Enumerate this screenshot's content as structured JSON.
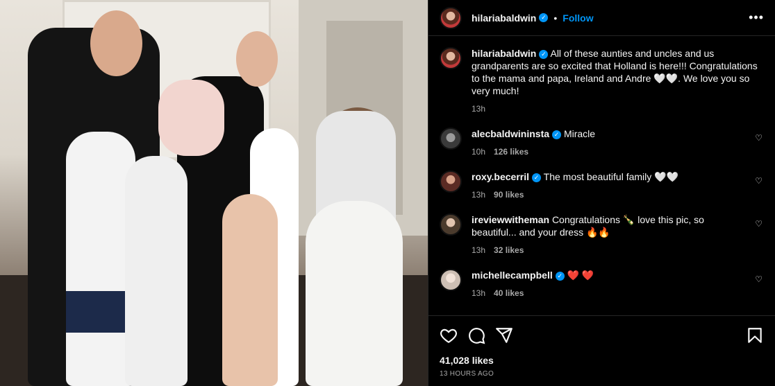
{
  "post": {
    "username": "hilariabaldwin",
    "follow_label": "Follow",
    "dot": "•",
    "more": "•••",
    "photo_alt": "Family photo"
  },
  "caption": {
    "username": "hilariabaldwin",
    "text": "All of these aunties and uncles and us grandparents are so excited that Holland is here!!! Congratulations to the mama and papa, Ireland and Andre 🤍🤍. We love you so very much!",
    "time": "13h"
  },
  "comments": [
    {
      "username": "alecbaldwininsta",
      "verified": true,
      "text": "Miracle",
      "time": "10h",
      "likes": "126 likes"
    },
    {
      "username": "roxy.becerril",
      "verified": true,
      "text": "The most beautiful family 🤍🤍",
      "time": "13h",
      "likes": "90 likes"
    },
    {
      "username": "ireviewwitheman",
      "verified": false,
      "text": "Congratulations 🍾 love this pic, so beautiful... and your dress 🔥🔥",
      "time": "13h",
      "likes": "32 likes"
    },
    {
      "username": "michellecampbell",
      "verified": true,
      "text": "❤️ ❤️",
      "time": "13h",
      "likes": "40 likes"
    }
  ],
  "footer": {
    "likes": "41,028 likes",
    "timestamp": "13 HOURS AGO"
  },
  "icons": {
    "verified": "✓",
    "heart": "♡"
  }
}
